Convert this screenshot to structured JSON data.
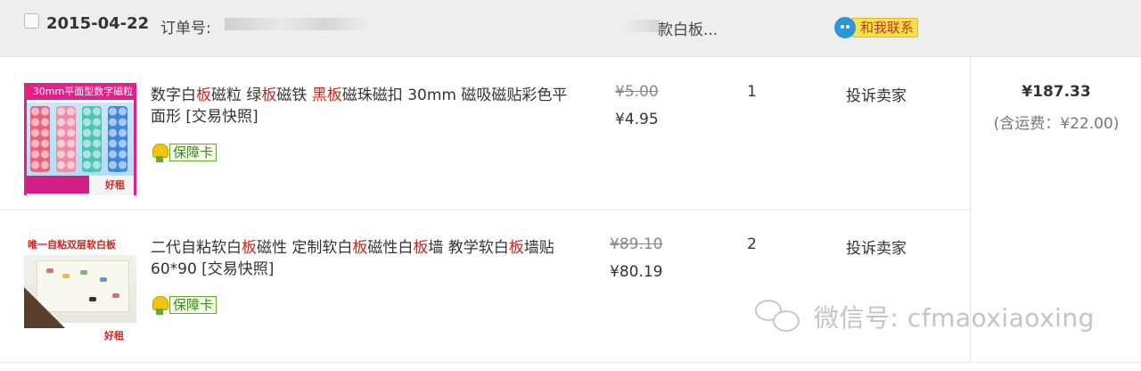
{
  "order": {
    "date": "2015-04-22",
    "order_no_label": "订单号:",
    "shop_name_visible": "款白板...",
    "contact_label": "和我联系"
  },
  "items": [
    {
      "title_parts": [
        "数字白",
        "板",
        "磁粒 绿",
        "板",
        "磁铁 ",
        "黑板",
        "磁珠磁扣 30mm 磁吸磁贴彩色平面形 [交易快照]"
      ],
      "thumb_caption": "30mm平面型数字磁粒",
      "thumb_logo": "好租",
      "badge": "保障卡",
      "price_original": "¥5.00",
      "price_current": "¥4.95",
      "quantity": "1",
      "action": "投诉卖家"
    },
    {
      "title_parts": [
        "二代自粘软白",
        "板",
        "磁性 定制软白",
        "板",
        "磁性白",
        "板",
        "墙 教学软白",
        "板",
        "墙贴 60*90 [交易快照]"
      ],
      "thumb_caption": "唯一自粘双层软白板",
      "thumb_logo": "好租",
      "badge": "保障卡",
      "price_original": "¥89.10",
      "price_current": "¥80.19",
      "quantity": "2",
      "action": "投诉卖家"
    }
  ],
  "summary": {
    "total": "¥187.33",
    "shipping": "(含运费：¥22.00)"
  },
  "watermark": {
    "text": "微信号: cfmaoxiaoxing",
    "icon": "wechat-icon"
  },
  "colors": {
    "keyword_highlight": "#c7261e",
    "header_bg": "#eeeeee",
    "contact_bg": "#f6e14a",
    "badge_green": "#3f8a1b"
  }
}
